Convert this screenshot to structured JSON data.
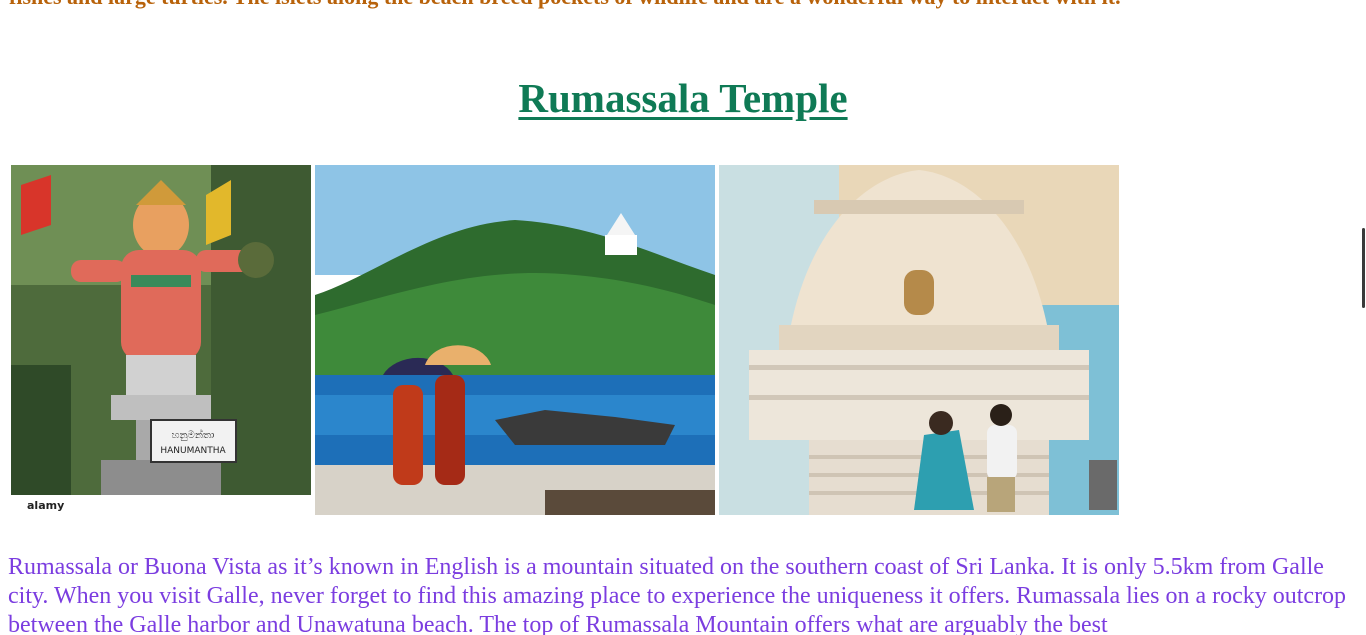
{
  "intro": {
    "text": "fishes and large turtles. The islets along the beach breed pockets of wildlife and are a wonderful way to interact with it."
  },
  "section": {
    "title": "Rumassala Temple"
  },
  "gallery": {
    "photo1": {
      "alt": "Hanuman statue",
      "watermark": "alamy",
      "sign_line1": "හනුමන්තා",
      "sign_line2": "HANUMANTHA"
    },
    "photo2": {
      "alt": "Monks with umbrellas on the beach near Rumassala"
    },
    "photo3": {
      "alt": "Couple at the Japanese Peace Pagoda"
    }
  },
  "body": {
    "paragraph": "Rumassala or Buona Vista as it’s known in English is a mountain situated on the southern coast of Sri Lanka. It is only 5.5km from Galle city. When you visit Galle, never forget to find this amazing place to experience the uniqueness it offers. Rumassala lies on a rocky outcrop between the Galle harbor and Unawatuna beach. The top of Rumassala Mountain offers what are arguably the best"
  },
  "colors": {
    "intro_text": "#b8620a",
    "title": "#0f7a55",
    "body_text": "#7b3de0"
  }
}
